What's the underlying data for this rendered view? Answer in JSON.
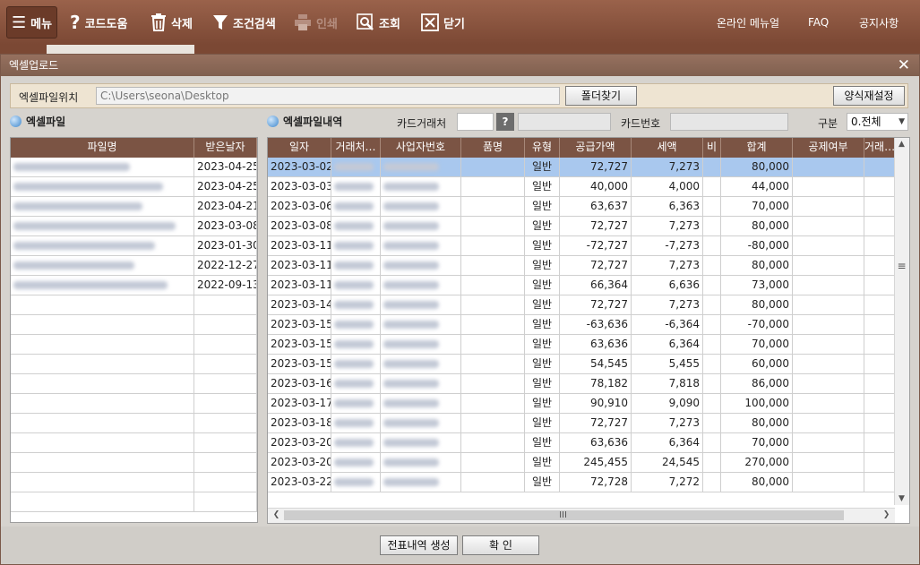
{
  "toolbar": {
    "menu": "메뉴",
    "code_help": "코드도움",
    "delete": "삭제",
    "search": "조건검색",
    "print": "인쇄",
    "view": "조회",
    "close": "닫기",
    "online_manual": "온라인 메뉴얼",
    "faq": "FAQ",
    "notice": "공지사항"
  },
  "dialog": {
    "title": "엑셀업로드",
    "path_label": "엑셀파일위치",
    "path_value": "C:\\Users\\seona\\Desktop",
    "folder_button": "폴더찾기",
    "form_reset_button": "양식재설정",
    "left_section": "엑셀파일",
    "right_section": "엑셀파일내역",
    "card_vendor_label": "카드거래처",
    "card_vendor_help": "?",
    "card_number_label": "카드번호",
    "type_label": "구분",
    "type_value": "0.전체",
    "create_button": "전표내역 생성",
    "ok_button": "확  인"
  },
  "files": {
    "headers": [
      "파일명",
      "받은날자"
    ],
    "rows": [
      {
        "date": "2023-04-25"
      },
      {
        "date": "2023-04-25"
      },
      {
        "date": "2023-04-21"
      },
      {
        "date": "2023-03-08"
      },
      {
        "date": "2023-01-30"
      },
      {
        "date": "2022-12-27"
      },
      {
        "date": "2022-09-13"
      }
    ]
  },
  "details": {
    "headers": [
      "일자",
      "거래처…",
      "사업자번호",
      "품명",
      "유형",
      "공급가액",
      "세액",
      "비",
      "합계",
      "공제여부",
      "거래…"
    ],
    "rows": [
      {
        "date": "2023-03-02",
        "type": "일반",
        "supply": "72,727",
        "tax": "7,273",
        "total": "80,000"
      },
      {
        "date": "2023-03-03",
        "type": "일반",
        "supply": "40,000",
        "tax": "4,000",
        "total": "44,000"
      },
      {
        "date": "2023-03-06",
        "type": "일반",
        "supply": "63,637",
        "tax": "6,363",
        "total": "70,000"
      },
      {
        "date": "2023-03-08",
        "type": "일반",
        "supply": "72,727",
        "tax": "7,273",
        "total": "80,000"
      },
      {
        "date": "2023-03-11",
        "type": "일반",
        "supply": "-72,727",
        "tax": "-7,273",
        "total": "-80,000"
      },
      {
        "date": "2023-03-11",
        "type": "일반",
        "supply": "72,727",
        "tax": "7,273",
        "total": "80,000"
      },
      {
        "date": "2023-03-11",
        "type": "일반",
        "supply": "66,364",
        "tax": "6,636",
        "total": "73,000"
      },
      {
        "date": "2023-03-14",
        "type": "일반",
        "supply": "72,727",
        "tax": "7,273",
        "total": "80,000"
      },
      {
        "date": "2023-03-15",
        "type": "일반",
        "supply": "-63,636",
        "tax": "-6,364",
        "total": "-70,000"
      },
      {
        "date": "2023-03-15",
        "type": "일반",
        "supply": "63,636",
        "tax": "6,364",
        "total": "70,000"
      },
      {
        "date": "2023-03-15",
        "type": "일반",
        "supply": "54,545",
        "tax": "5,455",
        "total": "60,000"
      },
      {
        "date": "2023-03-16",
        "type": "일반",
        "supply": "78,182",
        "tax": "7,818",
        "total": "86,000"
      },
      {
        "date": "2023-03-17",
        "type": "일반",
        "supply": "90,910",
        "tax": "9,090",
        "total": "100,000"
      },
      {
        "date": "2023-03-18",
        "type": "일반",
        "supply": "72,727",
        "tax": "7,273",
        "total": "80,000"
      },
      {
        "date": "2023-03-20",
        "type": "일반",
        "supply": "63,636",
        "tax": "6,364",
        "total": "70,000"
      },
      {
        "date": "2023-03-20",
        "type": "일반",
        "supply": "245,455",
        "tax": "24,545",
        "total": "270,000"
      },
      {
        "date": "2023-03-22",
        "type": "일반",
        "supply": "72,728",
        "tax": "7,272",
        "total": "80,000"
      }
    ]
  },
  "colors": {
    "toolbar_bg": "#8c5a44",
    "grid_header": "#7b5444",
    "selected_row": "#a9c8ee"
  }
}
